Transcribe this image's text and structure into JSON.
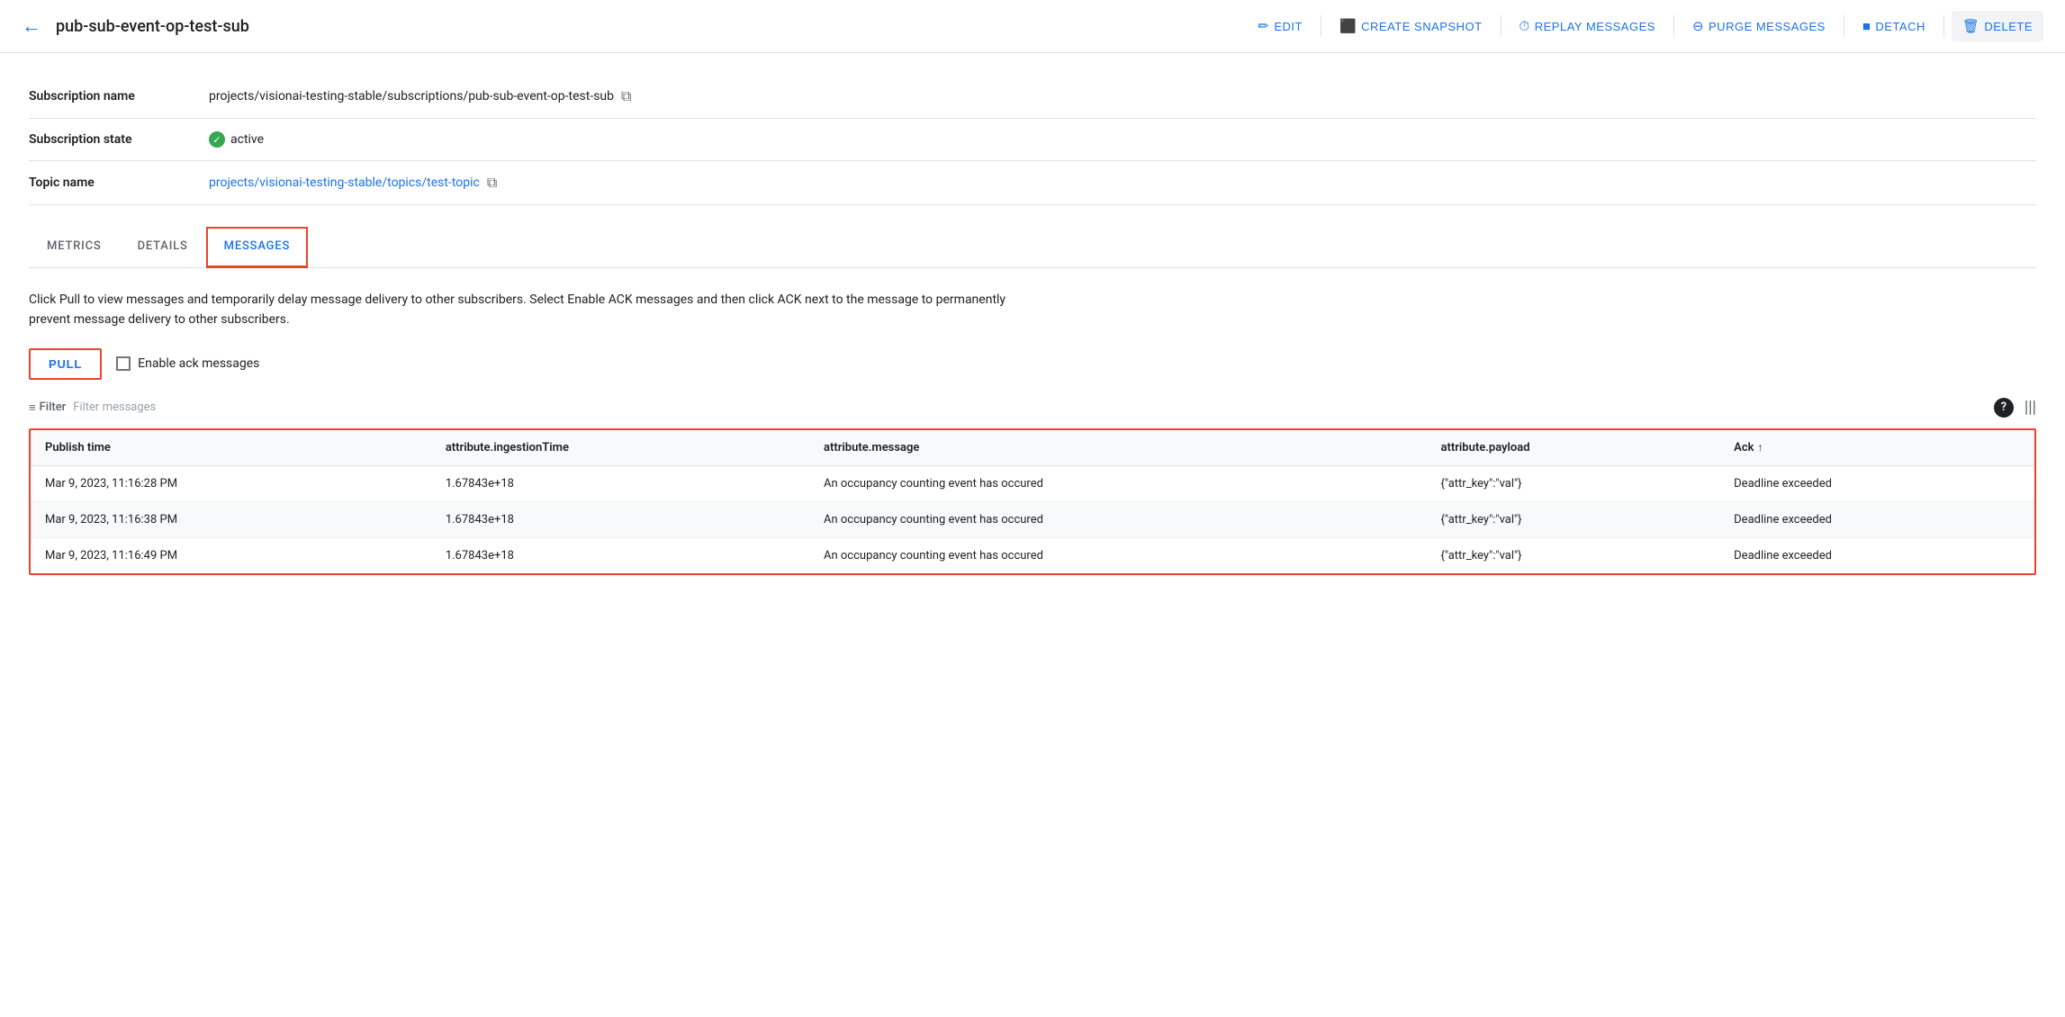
{
  "toolbar": {
    "back_label": "←",
    "title": "pub-sub-event-op-test-sub",
    "edit_label": "EDIT",
    "create_snapshot_label": "CREATE SNAPSHOT",
    "replay_messages_label": "REPLAY MESSAGES",
    "purge_messages_label": "PURGE MESSAGES",
    "detach_label": "DETACH",
    "delete_label": "DELETE"
  },
  "info": {
    "subscription_name_label": "Subscription name",
    "subscription_name_value": "projects/visionai-testing-stable/subscriptions/pub-sub-event-op-test-sub",
    "subscription_state_label": "Subscription state",
    "subscription_state_value": "active",
    "topic_name_label": "Topic name",
    "topic_name_value": "projects/visionai-testing-stable/topics/test-topic"
  },
  "tabs": {
    "metrics_label": "METRICS",
    "details_label": "DETAILS",
    "messages_label": "MESSAGES"
  },
  "messages_tab": {
    "description": "Click Pull to view messages and temporarily delay message delivery to other subscribers. Select Enable ACK messages and then click ACK next to the message to permanently prevent message delivery to other subscribers.",
    "pull_label": "PULL",
    "enable_ack_label": "Enable ack messages",
    "filter_label": "Filter",
    "filter_placeholder": "Filter messages",
    "table": {
      "columns": [
        {
          "key": "publish_time",
          "label": "Publish time"
        },
        {
          "key": "ingestion_time",
          "label": "attribute.ingestionTime"
        },
        {
          "key": "message",
          "label": "attribute.message"
        },
        {
          "key": "payload",
          "label": "attribute.payload"
        },
        {
          "key": "ack",
          "label": "Ack"
        }
      ],
      "rows": [
        {
          "publish_time": "Mar 9, 2023, 11:16:28 PM",
          "ingestion_time": "1.67843e+18",
          "message": "An occupancy counting event has occured",
          "payload": "{\"attr_key\":\"val\"}",
          "ack": "Deadline exceeded"
        },
        {
          "publish_time": "Mar 9, 2023, 11:16:38 PM",
          "ingestion_time": "1.67843e+18",
          "message": "An occupancy counting event has occured",
          "payload": "{\"attr_key\":\"val\"}",
          "ack": "Deadline exceeded"
        },
        {
          "publish_time": "Mar 9, 2023, 11:16:49 PM",
          "ingestion_time": "1.67843e+18",
          "message": "An occupancy counting event has occured",
          "payload": "{\"attr_key\":\"val\"}",
          "ack": "Deadline exceeded"
        }
      ]
    }
  },
  "icons": {
    "back": "←",
    "edit": "✏",
    "camera": "📷",
    "clock": "⏱",
    "minus_circle": "⊖",
    "square": "■",
    "trash": "🗑",
    "check": "✓",
    "copy": "⧉",
    "filter": "≡",
    "help": "?",
    "sort_asc": "↑",
    "columns": "|||"
  }
}
